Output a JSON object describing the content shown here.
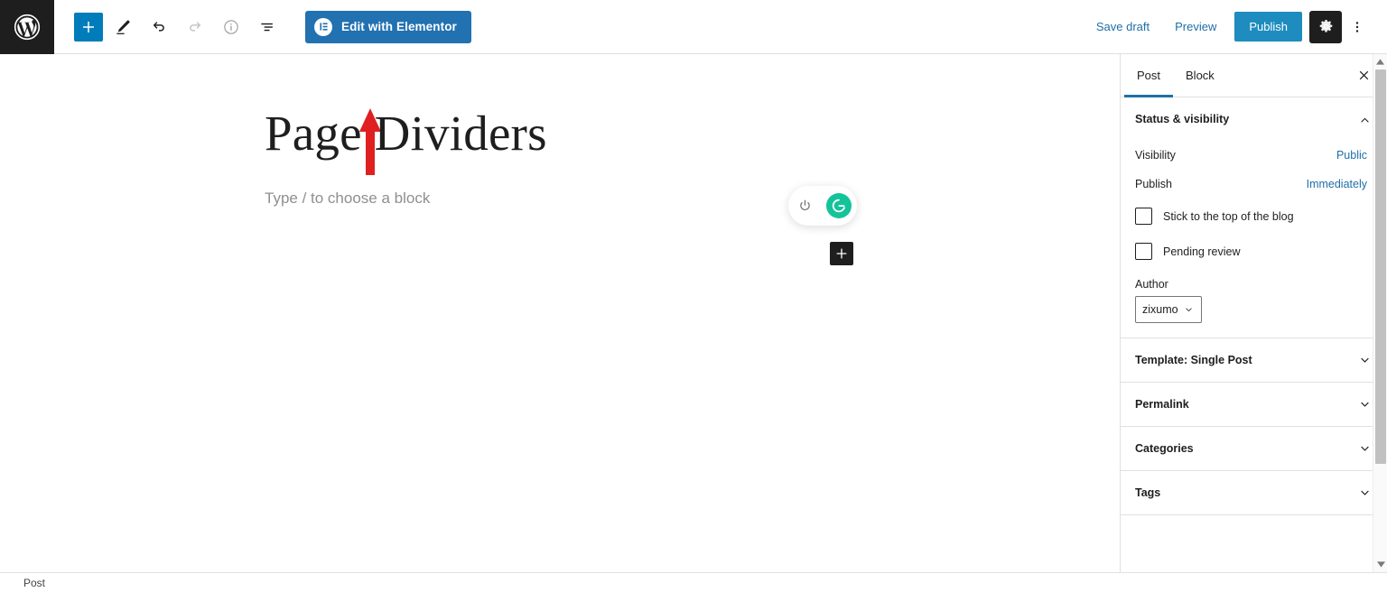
{
  "toolbar": {
    "wp_logo_name": "wordpress-logo",
    "add_block_label": "+",
    "buttons": [
      {
        "name": "add-block-button",
        "icon": "plus-icon",
        "label": "Add block"
      },
      {
        "name": "tools-button",
        "icon": "pencil-icon",
        "label": "Tools"
      },
      {
        "name": "undo-button",
        "icon": "undo-icon",
        "label": "Undo"
      },
      {
        "name": "redo-button",
        "icon": "redo-icon",
        "label": "Redo"
      },
      {
        "name": "details-button",
        "icon": "info-icon",
        "label": "Details"
      },
      {
        "name": "list-view-button",
        "icon": "list-view-icon",
        "label": "List view"
      }
    ],
    "elementor_label": "Edit with Elementor",
    "elementor_icon": "elementor-logo-icon",
    "save_draft_label": "Save draft",
    "preview_label": "Preview",
    "publish_label": "Publish",
    "settings_icon": "gear-icon",
    "more_icon": "kebab-menu-icon"
  },
  "editor": {
    "post_title": "Page Dividers",
    "block_placeholder": "Type / to choose a block",
    "inserter_label": "+",
    "grammarly": {
      "power_icon": "power-icon",
      "logo_icon": "grammarly-g-icon",
      "logo_letter": "G",
      "color": "#15c39a"
    },
    "annotation": {
      "type": "arrow-up",
      "color": "#e02020"
    }
  },
  "sidebar": {
    "tabs": [
      {
        "label": "Post",
        "active": true
      },
      {
        "label": "Block",
        "active": false
      }
    ],
    "close_icon": "close-icon",
    "status_panel": {
      "title": "Status & visibility",
      "expanded": true,
      "chevron": "chevron-up-icon",
      "rows": [
        {
          "label": "Visibility",
          "value": "Public"
        },
        {
          "label": "Publish",
          "value": "Immediately"
        }
      ],
      "checkboxes": [
        {
          "label": "Stick to the top of the blog",
          "checked": false
        },
        {
          "label": "Pending review",
          "checked": false
        }
      ],
      "author_label": "Author",
      "author_value": "zixumo"
    },
    "panels": [
      {
        "title": "Template: Single Post",
        "chevron": "chevron-down-icon"
      },
      {
        "title": "Permalink",
        "chevron": "chevron-down-icon"
      },
      {
        "title": "Categories",
        "chevron": "chevron-down-icon"
      },
      {
        "title": "Tags",
        "chevron": "chevron-down-icon"
      }
    ]
  },
  "bottombar": {
    "breadcrumb": "Post"
  },
  "colors": {
    "accent_blue": "#007cba",
    "publish_blue": "#1e8cbe",
    "elementor_blue": "#2271b1",
    "link_blue": "#1e6fa8",
    "dark": "#1e1e1e",
    "grammarly_green": "#15c39a",
    "annotation_red": "#e02020"
  }
}
